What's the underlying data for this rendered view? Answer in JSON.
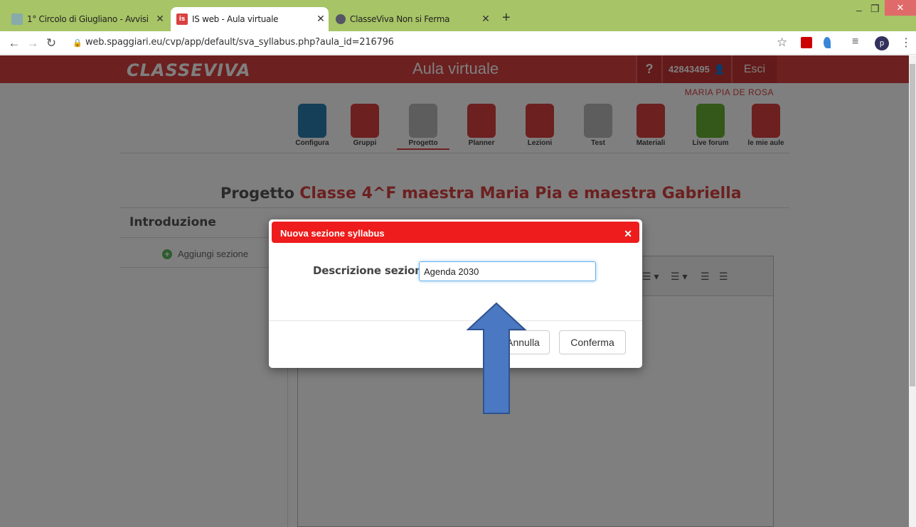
{
  "browser": {
    "tabs": [
      {
        "title": "1° Circolo di Giugliano - Avvisi"
      },
      {
        "title": "IS web - Aula virtuale"
      },
      {
        "title": "ClasseViva Non si Ferma"
      }
    ],
    "new_tab": "+",
    "url": "web.spaggiari.eu/cvp/app/default/sva_syllabus.php?aula_id=216796",
    "profile_initial": "p"
  },
  "header": {
    "logo": "CLASSEVIVA",
    "title": "Aula virtuale",
    "help": "?",
    "user_code": "42843495",
    "logout": "Esci",
    "username": "MARIA PIA DE ROSA"
  },
  "menu": [
    {
      "label": "Configura",
      "color": "#2b7fb3"
    },
    {
      "label": "Gruppi",
      "color": "#d94141"
    },
    {
      "label": "Progetto",
      "color": "#bbbbbb"
    },
    {
      "label": "Planner",
      "color": "#d94141"
    },
    {
      "label": "Lezioni",
      "color": "#d94141"
    },
    {
      "label": "Test",
      "color": "#bbbbbb"
    },
    {
      "label": "Materiali",
      "color": "#d94141"
    },
    {
      "label": "Live forum",
      "color": "#66b033"
    },
    {
      "label": "le mie aule",
      "color": "#d94141"
    }
  ],
  "page": {
    "title_prefix": "Progetto",
    "title_highlight": "Classe 4^F maestra Maria Pia e maestra Gabriella"
  },
  "sidebar": {
    "title": "Introduzione",
    "add_section": "Aggiungi sezione"
  },
  "modal": {
    "title": "Nuova sezione syllabus",
    "field_label": "Descrizione sezione",
    "field_value": "Agenda 2030",
    "cancel": "Annulla",
    "confirm": "Conferma"
  },
  "colors": {
    "brand": "#d94141",
    "modal_header": "#ee1c1c",
    "tabbar": "#a7c466",
    "arrow": "#4a78c2"
  }
}
